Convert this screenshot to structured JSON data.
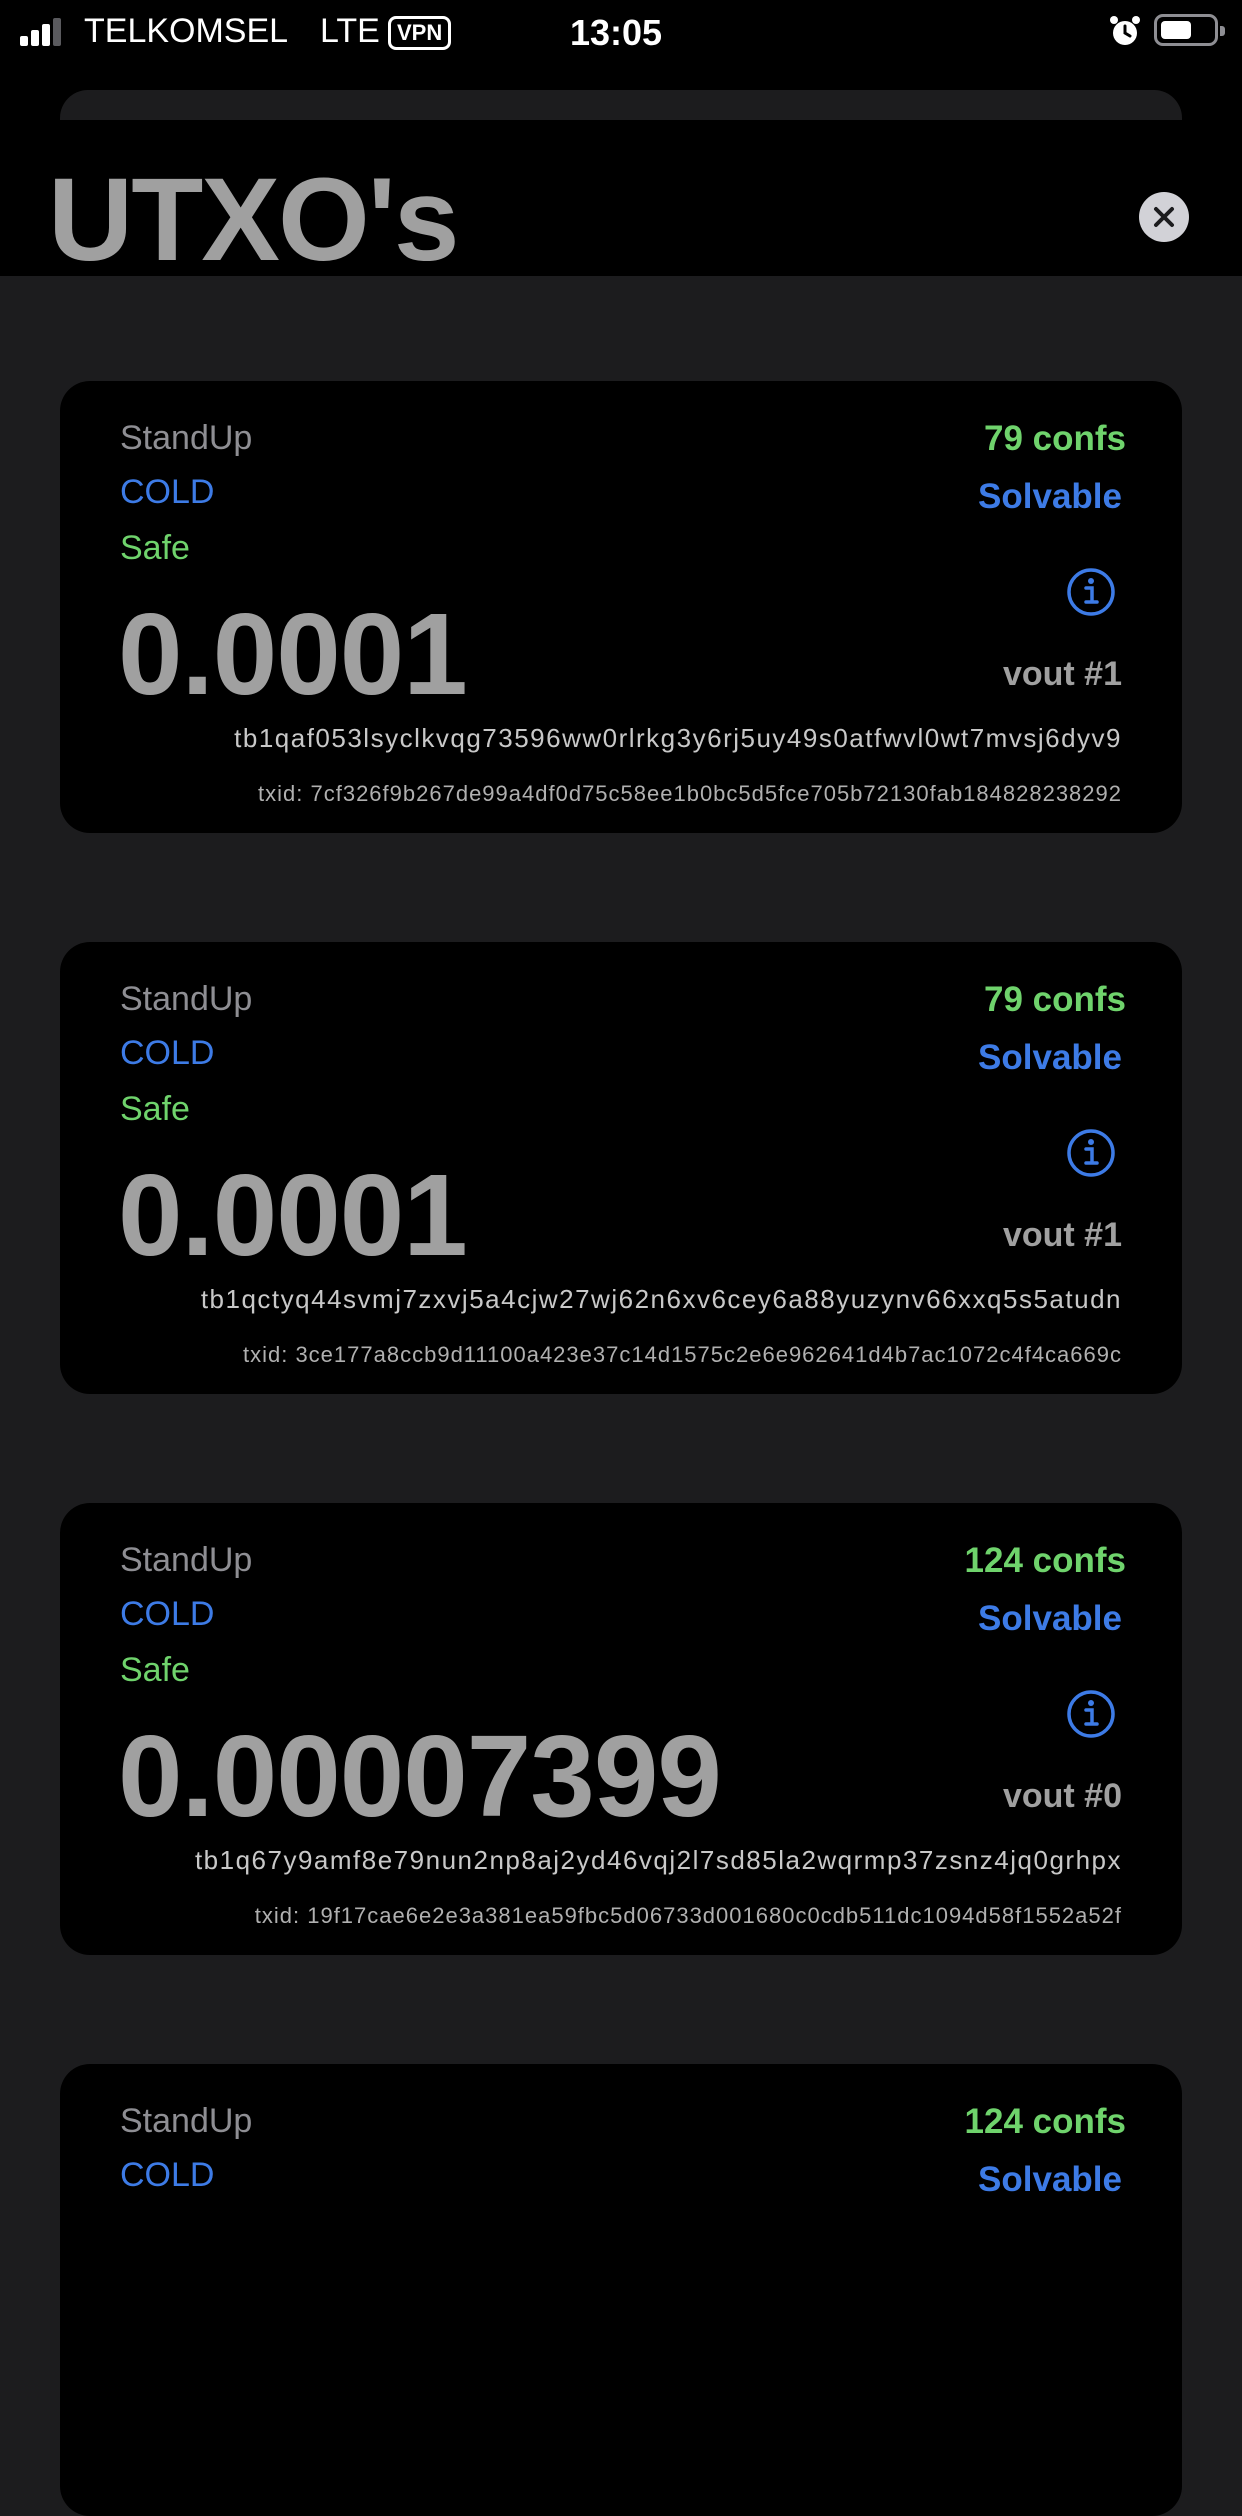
{
  "status_bar": {
    "carrier": "TELKOMSEL",
    "network": "LTE",
    "vpn": "VPN",
    "time": "13:05"
  },
  "header": {
    "title": "UTXO's"
  },
  "colors": {
    "green": "#6fd36c",
    "blue": "#3d7be6",
    "gray": "#a0a0a0",
    "background": "#1c1c1e"
  },
  "utxos": [
    {
      "wallet": "StandUp",
      "type": "COLD",
      "safe": "Safe",
      "confs": "79 confs",
      "solvable": "Solvable",
      "amount": "0.0001",
      "vout": "vout #1",
      "address": "tb1qaf053lsyclkvqg73596ww0rlrkg3y6rj5uy49s0atfwvl0wt7mvsj6dyv9",
      "txid": "txid: 7cf326f9b267de99a4df0d75c58ee1b0bc5d5fce705b72130fab184828238292"
    },
    {
      "wallet": "StandUp",
      "type": "COLD",
      "safe": "Safe",
      "confs": "79 confs",
      "solvable": "Solvable",
      "amount": "0.0001",
      "vout": "vout #1",
      "address": "tb1qctyq44svmj7zxvj5a4cjw27wj62n6xv6cey6a88yuzynv66xxq5s5atudn",
      "txid": "txid: 3ce177a8ccb9d11100a423e37c14d1575c2e6e962641d4b7ac1072c4f4ca669c"
    },
    {
      "wallet": "StandUp",
      "type": "COLD",
      "safe": "Safe",
      "confs": "124 confs",
      "solvable": "Solvable",
      "amount": "0.00007399",
      "vout": "vout #0",
      "address": "tb1q67y9amf8e79nun2np8aj2yd46vqj2l7sd85la2wqrmp37zsnz4jq0grhpx",
      "txid": "txid: 19f17cae6e2e3a381ea59fbc5d06733d001680c0cdb511dc1094d58f1552a52f"
    },
    {
      "wallet": "StandUp",
      "type": "COLD",
      "safe": "",
      "confs": "124 confs",
      "solvable": "Solvable",
      "amount": "",
      "vout": "",
      "address": "",
      "txid": ""
    }
  ]
}
